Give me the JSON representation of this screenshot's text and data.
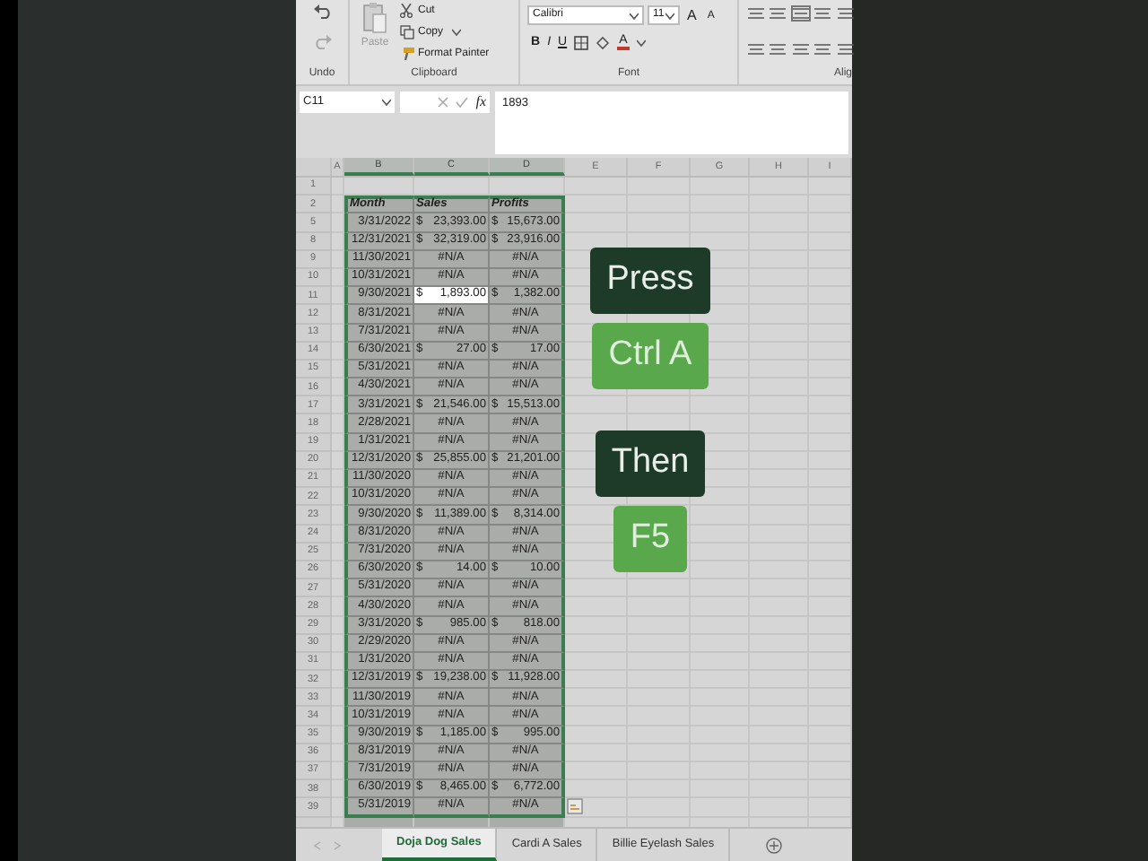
{
  "ribbon": {
    "undo": {
      "label": "Undo"
    },
    "clipboard": {
      "paste": "Paste",
      "cut": "Cut",
      "copy": "Copy",
      "format_painter": "Format Painter",
      "label": "Clipboard"
    },
    "font": {
      "family": "Calibri",
      "size": "11",
      "grow": "A",
      "shrink": "A",
      "bold": "B",
      "italic": "I",
      "underline": "U",
      "font_color_letter": "A",
      "label": "Font"
    },
    "alignment": {
      "label": "Alig"
    }
  },
  "formula_bar": {
    "name_box": "C11",
    "fx": "fx",
    "content": "1893"
  },
  "columns": [
    "A",
    "B",
    "C",
    "D",
    "E",
    "F",
    "G",
    "H",
    "I"
  ],
  "rows": [
    {
      "number": "1",
      "kind": "blank"
    },
    {
      "number": "2",
      "kind": "header",
      "cells": [
        "Month",
        "Sales",
        "Profits"
      ]
    },
    {
      "number": "5",
      "kind": "data",
      "cells": [
        {
          "text": "3/31/2022",
          "selected": false
        },
        {
          "currency": "$",
          "amount": "23,393.00",
          "selected": false
        },
        {
          "currency": "$",
          "amount": "15,673.00",
          "selected": false
        }
      ]
    },
    {
      "number": "8",
      "kind": "data",
      "cells": [
        {
          "text": "12/31/2021",
          "selected": false
        },
        {
          "currency": "$",
          "amount": "32,319.00",
          "selected": false
        },
        {
          "currency": "$",
          "amount": "23,916.00",
          "selected": false
        }
      ]
    },
    {
      "number": "9",
      "kind": "data",
      "cells": [
        {
          "text": "11/30/2021",
          "selected": false
        },
        {
          "text": "#N/A",
          "selected": false
        },
        {
          "text": "#N/A",
          "selected": false
        }
      ]
    },
    {
      "number": "10",
      "kind": "data",
      "cells": [
        {
          "text": "10/31/2021",
          "selected": false
        },
        {
          "text": "#N/A",
          "selected": false
        },
        {
          "text": "#N/A",
          "selected": false
        }
      ]
    },
    {
      "number": "11",
      "kind": "data",
      "cells": [
        {
          "text": "9/30/2021",
          "selected": false
        },
        {
          "currency": "$",
          "amount": "1,893.00",
          "selected": true
        },
        {
          "currency": "$",
          "amount": "1,382.00",
          "selected": false
        }
      ]
    },
    {
      "number": "12",
      "kind": "data",
      "cells": [
        {
          "text": "8/31/2021",
          "selected": false
        },
        {
          "text": "#N/A",
          "selected": false
        },
        {
          "text": "#N/A",
          "selected": false
        }
      ]
    },
    {
      "number": "13",
      "kind": "data",
      "cells": [
        {
          "text": "7/31/2021",
          "selected": false
        },
        {
          "text": "#N/A",
          "selected": false
        },
        {
          "text": "#N/A",
          "selected": false
        }
      ]
    },
    {
      "number": "14",
      "kind": "data",
      "cells": [
        {
          "text": "6/30/2021",
          "selected": false
        },
        {
          "currency": "$",
          "amount": "27.00",
          "selected": false
        },
        {
          "currency": "$",
          "amount": "17.00",
          "selected": false
        }
      ]
    },
    {
      "number": "15",
      "kind": "data",
      "cells": [
        {
          "text": "5/31/2021",
          "selected": false
        },
        {
          "text": "#N/A",
          "selected": false
        },
        {
          "text": "#N/A",
          "selected": false
        }
      ]
    },
    {
      "number": "16",
      "kind": "data",
      "cells": [
        {
          "text": "4/30/2021",
          "selected": false
        },
        {
          "text": "#N/A",
          "selected": false
        },
        {
          "text": "#N/A",
          "selected": false
        }
      ]
    },
    {
      "number": "17",
      "kind": "data",
      "cells": [
        {
          "text": "3/31/2021",
          "selected": false
        },
        {
          "currency": "$",
          "amount": "21,546.00",
          "selected": false
        },
        {
          "currency": "$",
          "amount": "15,513.00",
          "selected": false
        }
      ]
    },
    {
      "number": "18",
      "kind": "data",
      "cells": [
        {
          "text": "2/28/2021",
          "selected": false
        },
        {
          "text": "#N/A",
          "selected": false
        },
        {
          "text": "#N/A",
          "selected": false
        }
      ]
    },
    {
      "number": "19",
      "kind": "data",
      "cells": [
        {
          "text": "1/31/2021",
          "selected": false
        },
        {
          "text": "#N/A",
          "selected": false
        },
        {
          "text": "#N/A",
          "selected": false
        }
      ]
    },
    {
      "number": "20",
      "kind": "data",
      "cells": [
        {
          "text": "12/31/2020",
          "selected": false
        },
        {
          "currency": "$",
          "amount": "25,855.00",
          "selected": false
        },
        {
          "currency": "$",
          "amount": "21,201.00",
          "selected": false
        }
      ]
    },
    {
      "number": "21",
      "kind": "data",
      "cells": [
        {
          "text": "11/30/2020",
          "selected": false
        },
        {
          "text": "#N/A",
          "selected": false
        },
        {
          "text": "#N/A",
          "selected": false
        }
      ]
    },
    {
      "number": "22",
      "kind": "data",
      "cells": [
        {
          "text": "10/31/2020",
          "selected": false
        },
        {
          "text": "#N/A",
          "selected": false
        },
        {
          "text": "#N/A",
          "selected": false
        }
      ]
    },
    {
      "number": "23",
      "kind": "data",
      "cells": [
        {
          "text": "9/30/2020",
          "selected": false
        },
        {
          "currency": "$",
          "amount": "11,389.00",
          "selected": false
        },
        {
          "currency": "$",
          "amount": "8,314.00",
          "selected": false
        }
      ]
    },
    {
      "number": "24",
      "kind": "data",
      "cells": [
        {
          "text": "8/31/2020",
          "selected": false
        },
        {
          "text": "#N/A",
          "selected": false
        },
        {
          "text": "#N/A",
          "selected": false
        }
      ]
    },
    {
      "number": "25",
      "kind": "data",
      "cells": [
        {
          "text": "7/31/2020",
          "selected": false
        },
        {
          "text": "#N/A",
          "selected": false
        },
        {
          "text": "#N/A",
          "selected": false
        }
      ]
    },
    {
      "number": "26",
      "kind": "data",
      "cells": [
        {
          "text": "6/30/2020",
          "selected": false
        },
        {
          "currency": "$",
          "amount": "14.00",
          "selected": false
        },
        {
          "currency": "$",
          "amount": "10.00",
          "selected": false
        }
      ]
    },
    {
      "number": "27",
      "kind": "data",
      "cells": [
        {
          "text": "5/31/2020",
          "selected": false
        },
        {
          "text": "#N/A",
          "selected": false
        },
        {
          "text": "#N/A",
          "selected": false
        }
      ]
    },
    {
      "number": "28",
      "kind": "data",
      "cells": [
        {
          "text": "4/30/2020",
          "selected": false
        },
        {
          "text": "#N/A",
          "selected": false
        },
        {
          "text": "#N/A",
          "selected": false
        }
      ]
    },
    {
      "number": "29",
      "kind": "data",
      "cells": [
        {
          "text": "3/31/2020",
          "selected": false
        },
        {
          "currency": "$",
          "amount": "985.00",
          "selected": false
        },
        {
          "currency": "$",
          "amount": "818.00",
          "selected": false
        }
      ]
    },
    {
      "number": "30",
      "kind": "data",
      "cells": [
        {
          "text": "2/29/2020",
          "selected": false
        },
        {
          "text": "#N/A",
          "selected": false
        },
        {
          "text": "#N/A",
          "selected": false
        }
      ]
    },
    {
      "number": "31",
      "kind": "data",
      "cells": [
        {
          "text": "1/31/2020",
          "selected": false
        },
        {
          "text": "#N/A",
          "selected": false
        },
        {
          "text": "#N/A",
          "selected": false
        }
      ]
    },
    {
      "number": "32",
      "kind": "data",
      "cells": [
        {
          "text": "12/31/2019",
          "selected": false
        },
        {
          "currency": "$",
          "amount": "19,238.00",
          "selected": false
        },
        {
          "currency": "$",
          "amount": "11,928.00",
          "selected": false
        }
      ]
    },
    {
      "number": "33",
      "kind": "data",
      "cells": [
        {
          "text": "11/30/2019",
          "selected": false
        },
        {
          "text": "#N/A",
          "selected": false
        },
        {
          "text": "#N/A",
          "selected": false
        }
      ]
    },
    {
      "number": "34",
      "kind": "data",
      "cells": [
        {
          "text": "10/31/2019",
          "selected": false
        },
        {
          "text": "#N/A",
          "selected": false
        },
        {
          "text": "#N/A",
          "selected": false
        }
      ]
    },
    {
      "number": "35",
      "kind": "data",
      "cells": [
        {
          "text": "9/30/2019",
          "selected": false
        },
        {
          "currency": "$",
          "amount": "1,185.00",
          "selected": false
        },
        {
          "currency": "$",
          "amount": "995.00",
          "selected": false
        }
      ]
    },
    {
      "number": "36",
      "kind": "data",
      "cells": [
        {
          "text": "8/31/2019",
          "selected": false
        },
        {
          "text": "#N/A",
          "selected": false
        },
        {
          "text": "#N/A",
          "selected": false
        }
      ]
    },
    {
      "number": "37",
      "kind": "data",
      "cells": [
        {
          "text": "7/31/2019",
          "selected": false
        },
        {
          "text": "#N/A",
          "selected": false
        },
        {
          "text": "#N/A",
          "selected": false
        }
      ]
    },
    {
      "number": "38",
      "kind": "data",
      "cells": [
        {
          "text": "6/30/2019",
          "selected": false
        },
        {
          "currency": "$",
          "amount": "8,465.00",
          "selected": false
        },
        {
          "currency": "$",
          "amount": "6,772.00",
          "selected": false
        }
      ]
    },
    {
      "number": "39",
      "kind": "data",
      "cells": [
        {
          "text": "5/31/2019",
          "selected": false
        },
        {
          "text": "#N/A",
          "selected": false
        },
        {
          "text": "#N/A",
          "selected": false
        }
      ]
    }
  ],
  "captions": [
    {
      "text": "Press",
      "kind": "dark"
    },
    {
      "text": "Ctrl A",
      "kind": "light"
    },
    {
      "text": "Then",
      "kind": "dark"
    },
    {
      "text": "F5",
      "kind": "light"
    }
  ],
  "sheet_tabs": [
    {
      "label": "Doja Dog Sales",
      "selected": true
    },
    {
      "label": "Cardi A Sales",
      "selected": false
    },
    {
      "label": "Billie Eyelash Sales",
      "selected": false
    }
  ]
}
